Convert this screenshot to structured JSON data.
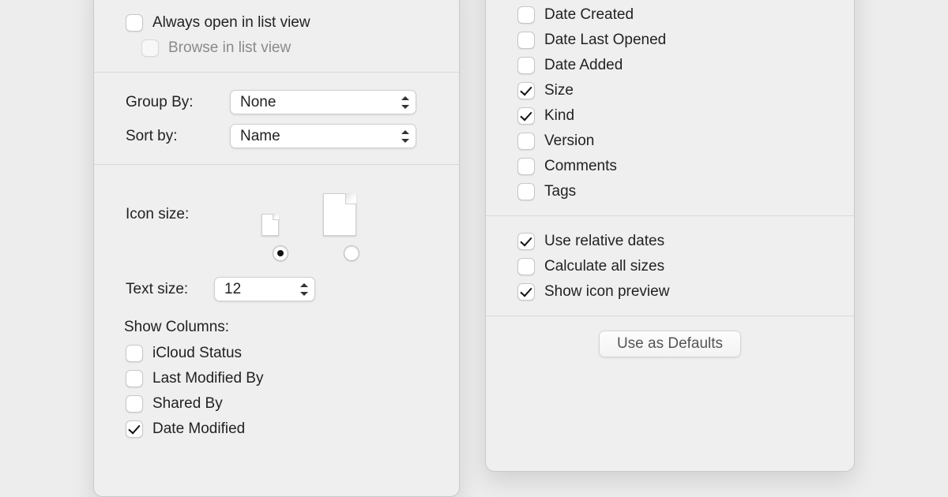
{
  "left": {
    "always_open": {
      "label": "Always open in list view",
      "checked": false
    },
    "browse": {
      "label": "Browse in list view",
      "checked": false,
      "disabled": true
    },
    "group_by": {
      "label": "Group By:",
      "value": "None"
    },
    "sort_by": {
      "label": "Sort by:",
      "value": "Name"
    },
    "icon_size": {
      "label": "Icon size:",
      "selected": "small"
    },
    "text_size": {
      "label": "Text size:",
      "value": "12"
    },
    "show_columns_label": "Show Columns:",
    "columns": [
      {
        "label": "iCloud Status",
        "checked": false
      },
      {
        "label": "Last Modified By",
        "checked": false
      },
      {
        "label": "Shared By",
        "checked": false
      },
      {
        "label": "Date Modified",
        "checked": true
      }
    ]
  },
  "right": {
    "columns": [
      {
        "label": "Date Created",
        "checked": false
      },
      {
        "label": "Date Last Opened",
        "checked": false
      },
      {
        "label": "Date Added",
        "checked": false
      },
      {
        "label": "Size",
        "checked": true
      },
      {
        "label": "Kind",
        "checked": true
      },
      {
        "label": "Version",
        "checked": false
      },
      {
        "label": "Comments",
        "checked": false
      },
      {
        "label": "Tags",
        "checked": false
      }
    ],
    "options": [
      {
        "label": "Use relative dates",
        "checked": true
      },
      {
        "label": "Calculate all sizes",
        "checked": false
      },
      {
        "label": "Show icon preview",
        "checked": true
      }
    ],
    "defaults_button": "Use as Defaults"
  }
}
